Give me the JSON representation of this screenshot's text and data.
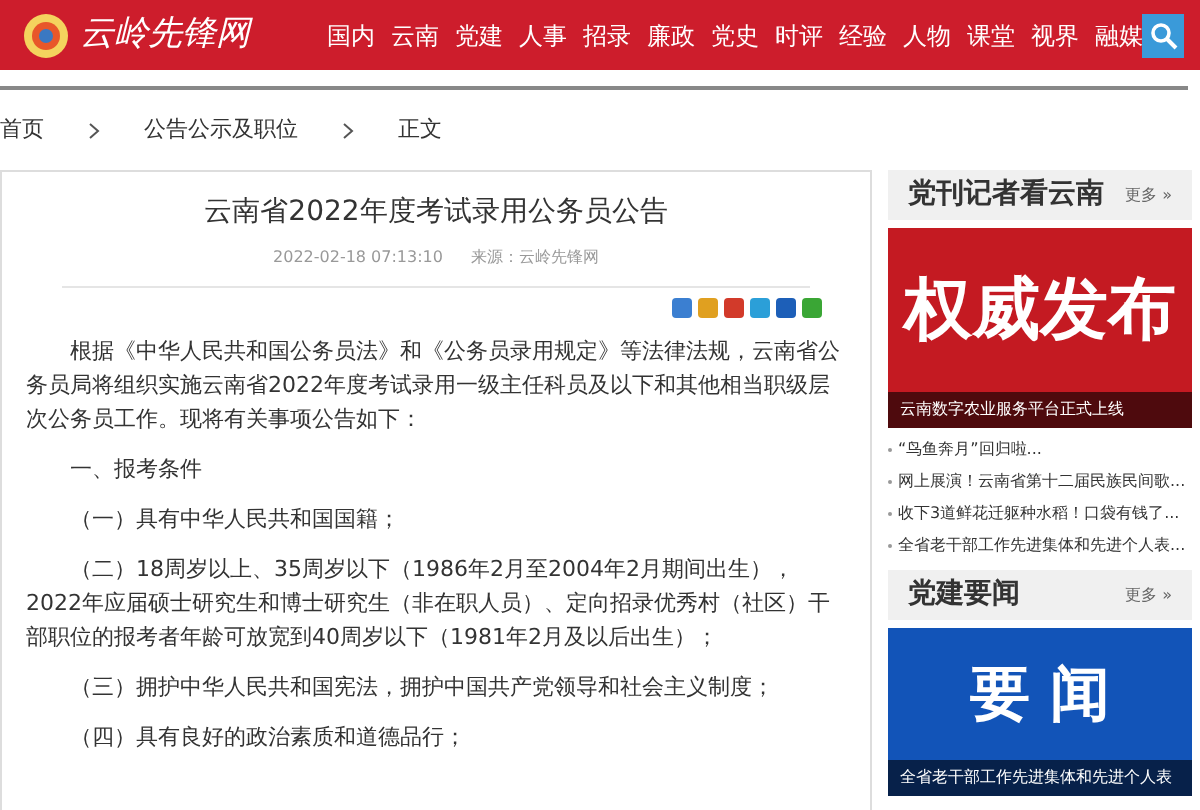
{
  "header": {
    "logo": "云岭先锋网",
    "nav": [
      {
        "label": "国内"
      },
      {
        "label": "云南"
      },
      {
        "label": "党建"
      },
      {
        "label": "人事"
      },
      {
        "label": "招录"
      },
      {
        "label": "廉政"
      },
      {
        "label": "党史"
      },
      {
        "label": "时评"
      },
      {
        "label": "经验"
      },
      {
        "label": "人物"
      },
      {
        "label": "课堂"
      },
      {
        "label": "视界"
      },
      {
        "label": "融媒"
      }
    ]
  },
  "breadcrumb": [
    {
      "label": "首页"
    },
    {
      "label": "公告公示及职位"
    },
    {
      "label": "正文"
    }
  ],
  "article": {
    "title": "云南省2022年度考试录用公务员公告",
    "date": "2022-02-18 07:13:10",
    "source": "来源：云岭先锋网",
    "share": [
      {
        "color": "#3b7fd1"
      },
      {
        "color": "#e0a020"
      },
      {
        "color": "#d23a2a"
      },
      {
        "color": "#2b9fd8"
      },
      {
        "color": "#1d5fb8"
      },
      {
        "color": "#3aa635"
      }
    ],
    "paragraphs": [
      "根据《中华人民共和国公务员法》和《公务员录用规定》等法律法规，云南省公务员局将组织实施云南省2022年度考试录用一级主任科员及以下和其他相当职级层次公务员工作。现将有关事项公告如下：",
      "一、报考条件",
      "（一）具有中华人民共和国国籍；",
      "（二）18周岁以上、35周岁以下（1986年2月至2004年2月期间出生），2022年应届硕士研究生和博士研究生（非在职人员）、定向招录优秀村（社区）干部职位的报考者年龄可放宽到40周岁以下（1981年2月及以后出生）；",
      "（三）拥护中华人民共和国宪法，拥护中国共产党领导和社会主义制度；",
      "（四）具有良好的政治素质和道德品行；"
    ]
  },
  "sidebar": [
    {
      "title": "党刊记者看云南",
      "more": "更多 »",
      "banner": {
        "headline": "权威发布",
        "caption": "云南数字农业服务平台正式上线"
      },
      "items": [
        "“鸟鱼奔月”回归啦...",
        "网上展演！云南省第十二届民族民间歌...",
        "收下3道鲜花迁躯种水稻！口袋有钱了...",
        "全省老干部工作先进集体和先进个人表..."
      ]
    },
    {
      "title": "党建要闻",
      "more": "更多 »",
      "banner": {
        "headline": "要 闻",
        "caption": "全省老干部工作先进集体和先进个人表"
      }
    }
  ]
}
